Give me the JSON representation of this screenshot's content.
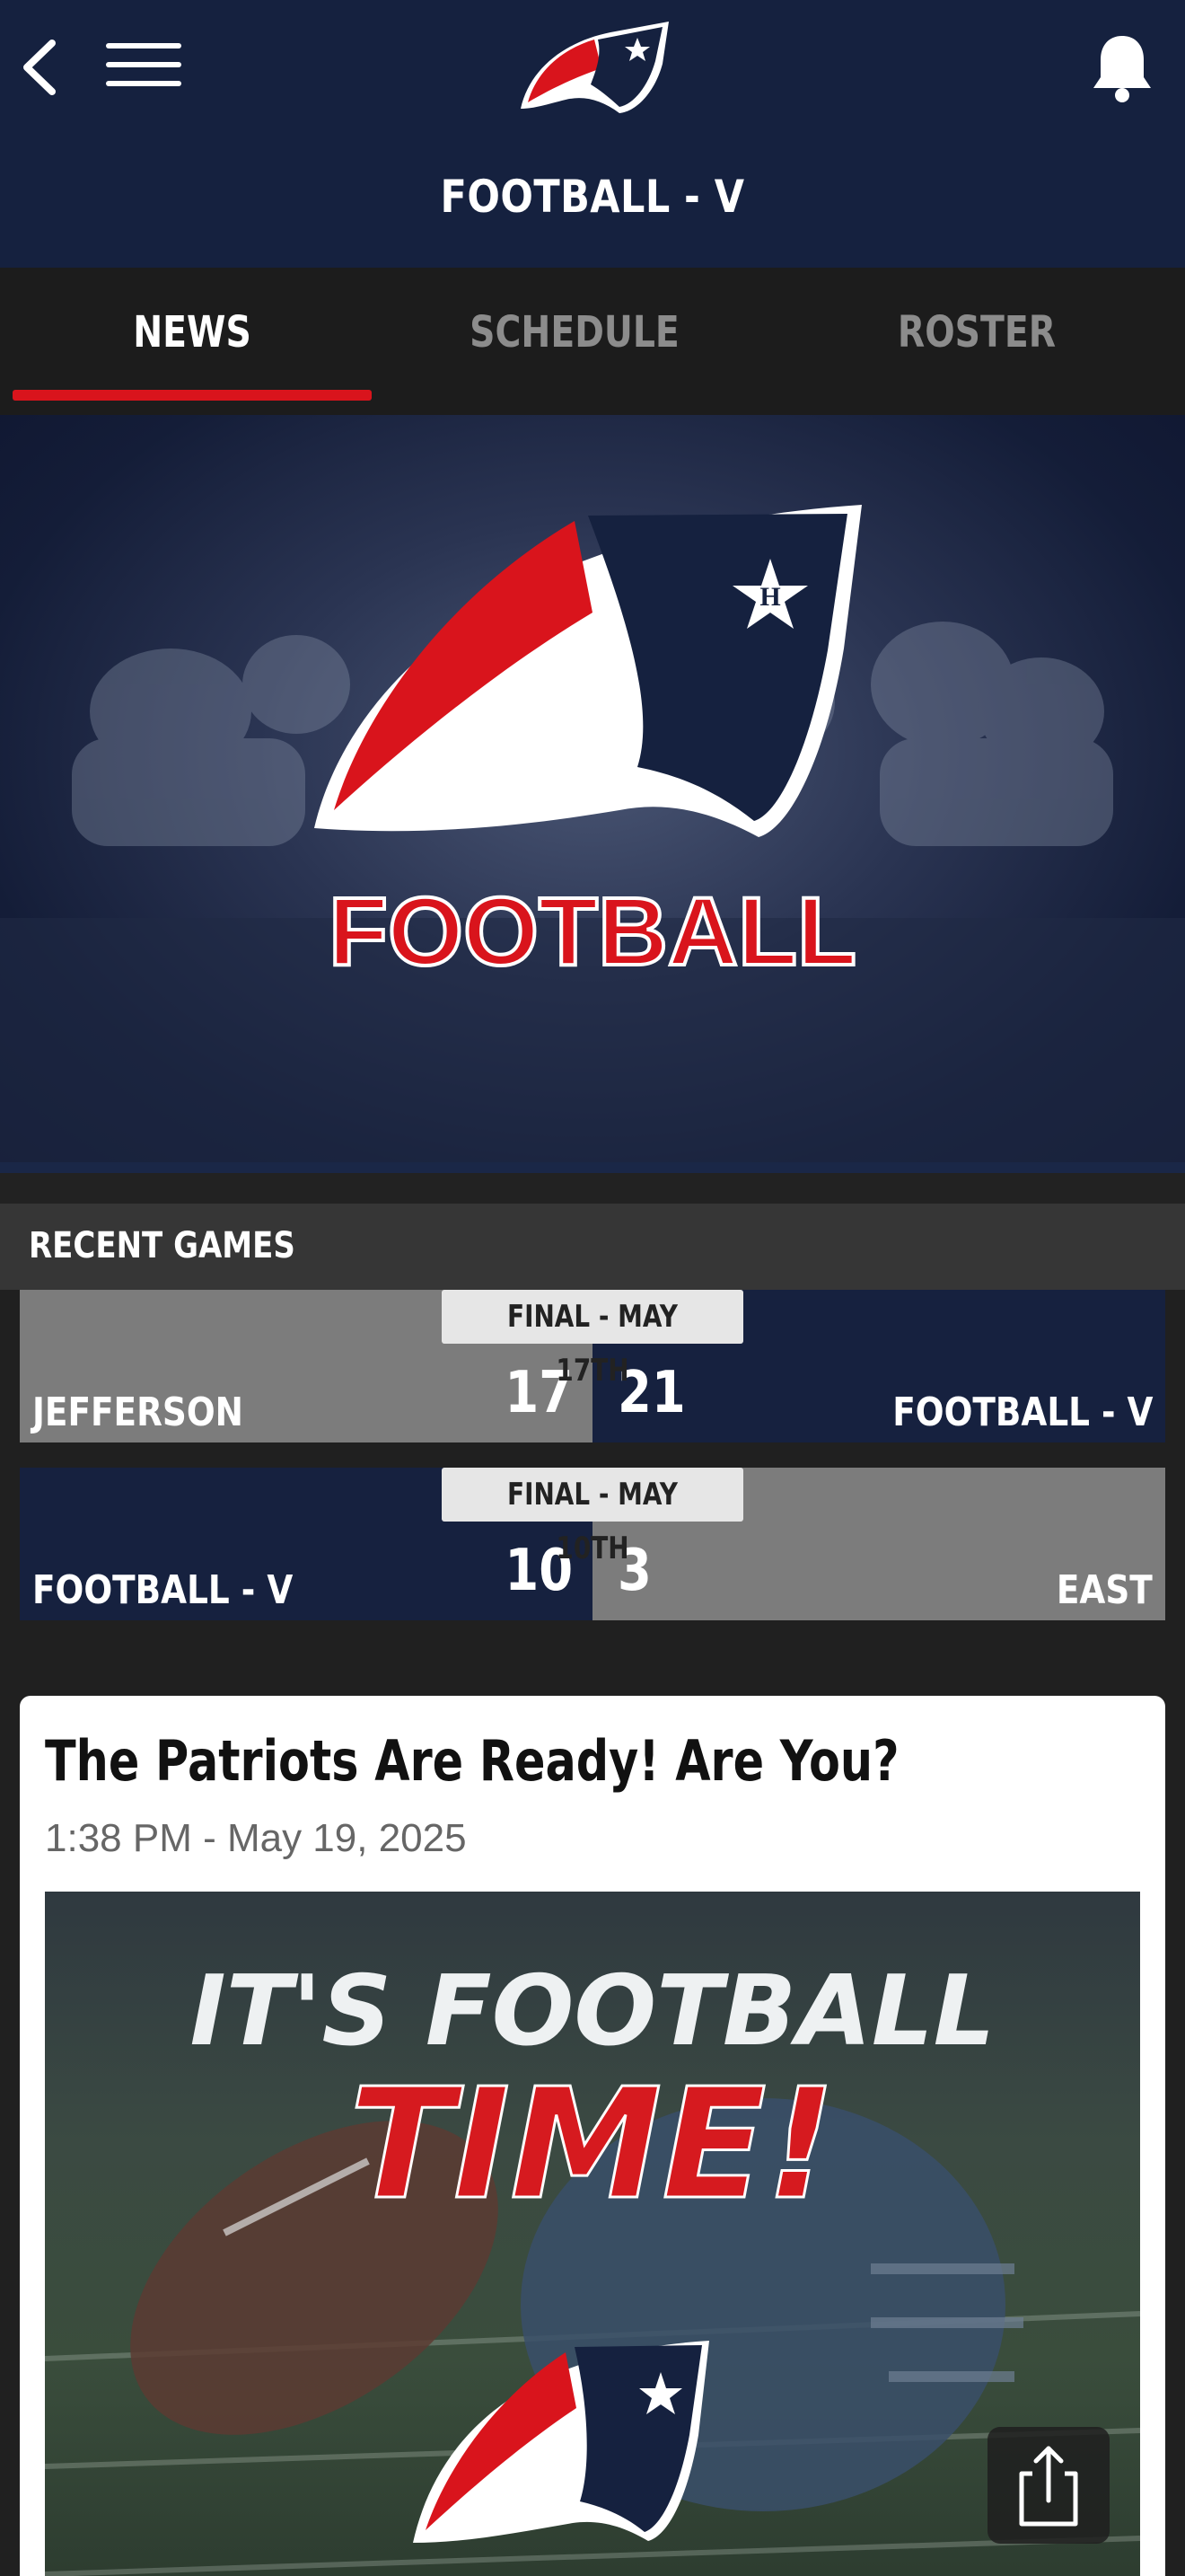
{
  "header": {
    "title": "FOOTBALL - V",
    "icons": {
      "back": "back-chevron-icon",
      "menu": "hamburger-menu-icon",
      "logo": "patriot-logo",
      "notifications": "bell-icon"
    }
  },
  "tabs": [
    {
      "label": "NEWS",
      "active": true
    },
    {
      "label": "SCHEDULE",
      "active": false
    },
    {
      "label": "ROSTER",
      "active": false
    }
  ],
  "hero": {
    "text": "FOOTBALL"
  },
  "recent_games": {
    "title": "RECENT GAMES",
    "games": [
      {
        "label": "FINAL - MAY 17TH",
        "left_team": "JEFFERSON",
        "left_score": "17",
        "right_score": "21",
        "right_team": "FOOTBALL - V"
      },
      {
        "label": "FINAL - MAY 10TH",
        "left_team": "FOOTBALL - V",
        "left_score": "10",
        "right_score": "3",
        "right_team": "EAST"
      }
    ]
  },
  "article": {
    "title": "The Patriots Are Ready! Are You?",
    "timestamp": "1:38 PM - May 19, 2025",
    "image_text_line1": "IT'S FOOTBALL",
    "image_text_line2": "TIME!"
  },
  "colors": {
    "navy": "#15213f",
    "red": "#d9141c",
    "gray": "#7c7c7c"
  }
}
